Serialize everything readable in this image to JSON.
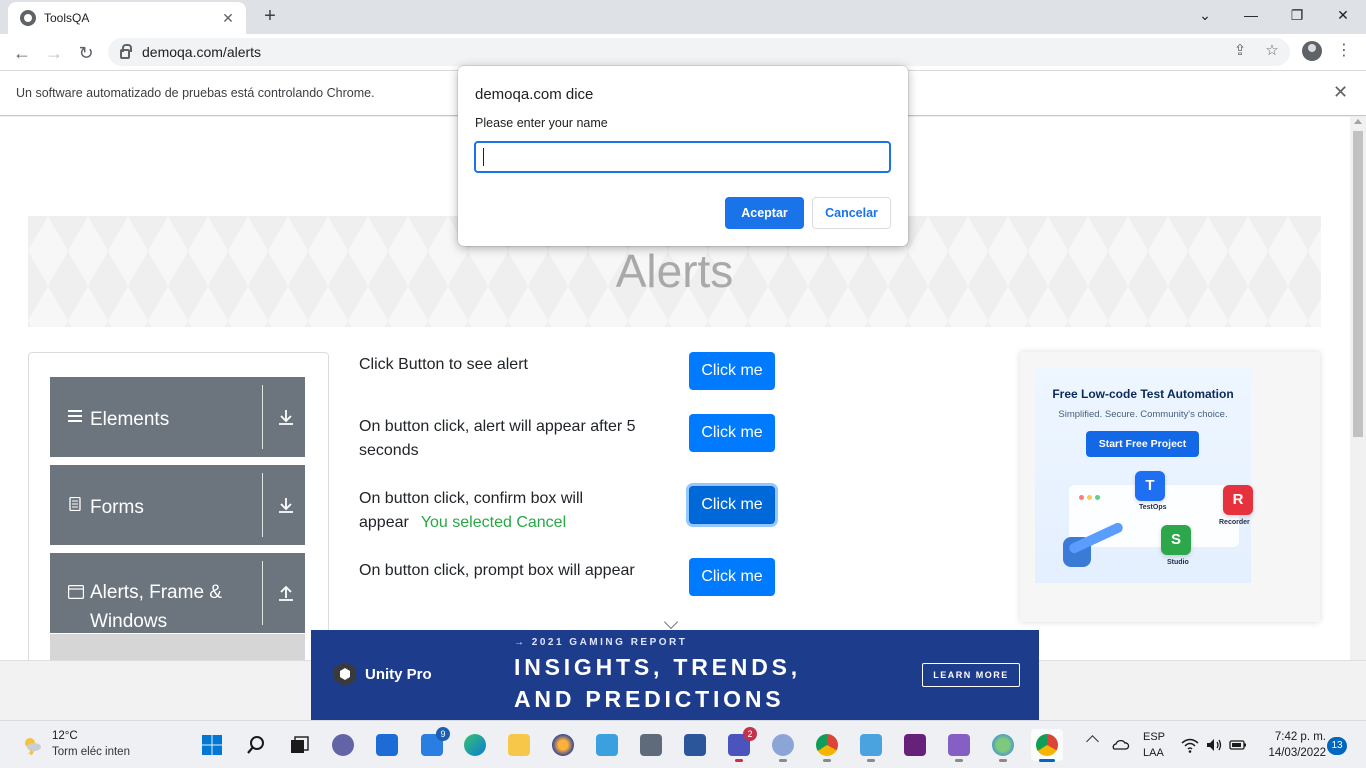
{
  "browser": {
    "tab_title": "ToolsQA",
    "tab_close": "✕",
    "new_tab": "+",
    "url": "demoqa.com/alerts",
    "infobar_message": "Un software automatizado de pruebas está controlando Chrome.",
    "infobar_close": "✕",
    "window_controls": {
      "minimize": "—",
      "maximize": "❐",
      "close": "✕",
      "tab_search": "⌄"
    }
  },
  "page": {
    "title": "Alerts",
    "menu_groups": [
      {
        "label": "Elements"
      },
      {
        "label": "Forms"
      },
      {
        "label": "Alerts, Frame & Windows"
      }
    ],
    "rows": [
      {
        "text": "Click Button to see alert",
        "button": "Click me"
      },
      {
        "text": "On button click, alert will appear after 5 seconds",
        "button": "Click me"
      },
      {
        "text": "On button click, confirm box will appear",
        "result": "You selected Cancel",
        "button": "Click me"
      },
      {
        "text": "On button click, prompt box will appear",
        "button": "Click me"
      }
    ]
  },
  "ad_right": {
    "headline": "Free Low-code Test Automation",
    "subline": "Simplified. Secure. Community's choice.",
    "cta": "Start Free Project",
    "labels": {
      "testops": "TestOps",
      "recorder": "Recorder",
      "studio": "Studio"
    },
    "chips": {
      "testops": "T",
      "recorder": "R",
      "studio": "S"
    }
  },
  "ad_bottom": {
    "brand": "Unity Pro",
    "kicker": "→ 2021 GAMING REPORT",
    "headline_line1": "INSIGHTS, TRENDS,",
    "headline_line2": "AND PREDICTIONS",
    "cta": "LEARN MORE"
  },
  "dialog": {
    "title": "demoqa.com dice",
    "message": "Please enter your name",
    "input_value": "",
    "ok_label": "Aceptar",
    "cancel_label": "Cancelar"
  },
  "taskbar": {
    "weather_temp": "12°C",
    "weather_desc": "Torm eléc inten",
    "mail_badge": "9",
    "teams_badge": "2",
    "lang_line1": "ESP",
    "lang_line2": "LAA",
    "time": "7:42 p. m.",
    "date": "14/03/2022",
    "notifications": "13"
  },
  "colors": {
    "primary_button": "#007bff",
    "menu_group_bg": "#6c757d",
    "success_text": "#28a745",
    "dialog_accent": "#1a73e8",
    "unity_ad_bg": "#1e3c8c"
  }
}
